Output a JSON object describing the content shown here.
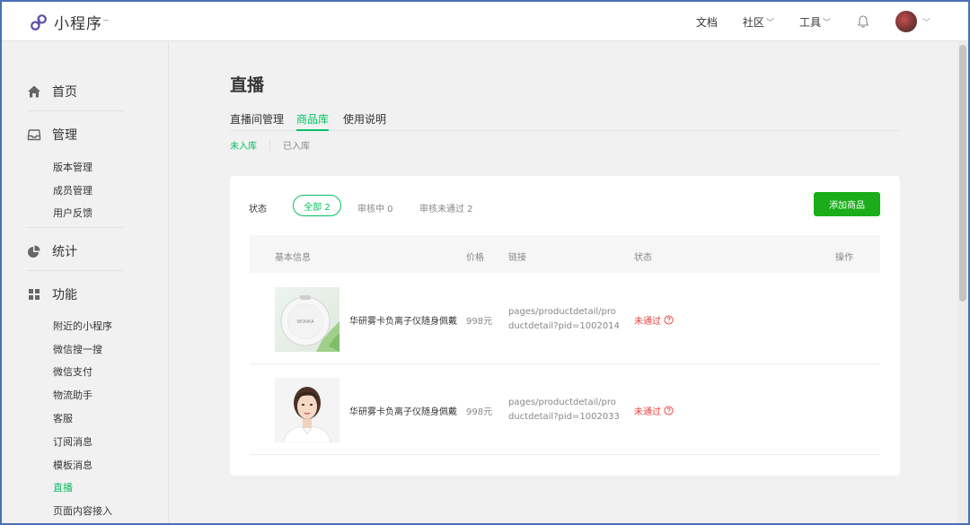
{
  "app": {
    "logo_text": "小程序",
    "logo_mark": "~"
  },
  "topnav": {
    "docs": "文档",
    "community": "社区",
    "tools": "工具"
  },
  "sidebar": {
    "sections": {
      "home": "首页",
      "manage": "管理",
      "stats": "统计",
      "features": "功能"
    },
    "manage_items": [
      "版本管理",
      "成员管理",
      "用户反馈"
    ],
    "feature_items": [
      "附近的小程序",
      "微信搜一搜",
      "微信支付",
      "物流助手",
      "客服",
      "订阅消息",
      "模板消息",
      "直播",
      "页面内容接入"
    ],
    "active_item": "直播"
  },
  "main": {
    "title": "直播",
    "tabs": [
      "直播间管理",
      "商品库",
      "使用说明"
    ],
    "active_tab": "商品库",
    "subtabs": [
      "未入库",
      "已入库"
    ],
    "active_subtab": "未入库",
    "filter": {
      "label": "状态",
      "all": "全部 2",
      "reviewing": "审核中 0",
      "rejected": "审核未通过 2"
    },
    "add_button": "添加商品",
    "table": {
      "headers": {
        "info": "基本信息",
        "price": "价格",
        "link": "链接",
        "status": "状态",
        "action": "操作"
      },
      "rows": [
        {
          "name": "华研雾卡负离子仪随身佩戴",
          "price": "998元",
          "link": "pages/productdetail/productdetail?pid=1002014",
          "status": "未通过",
          "thumb_label": "WONKA"
        },
        {
          "name": "华研雾卡负离子仪随身佩戴",
          "price": "998元",
          "link": "pages/productdetail/productdetail?pid=1002033",
          "status": "未通过"
        }
      ]
    }
  },
  "colors": {
    "accent": "#07c160",
    "button": "#1aad19",
    "error": "#e64340",
    "frame": "#4a6fb5"
  }
}
